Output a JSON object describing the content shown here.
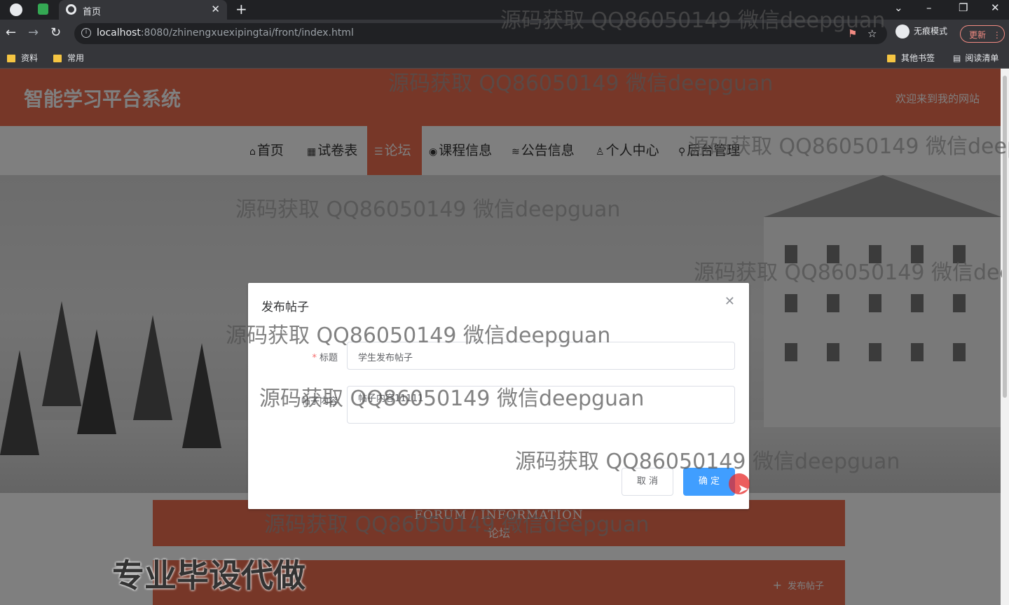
{
  "browser": {
    "tab_title": "首页",
    "new_tab": "+",
    "url_host": "localhost",
    "url_path": ":8080/zhinengxuexipingtai/front/index.html",
    "incognito_label": "无痕模式",
    "update_label": "更新",
    "bookmarks": [
      "资料",
      "常用"
    ],
    "bookmarks_right": [
      "其他书签",
      "阅读清单"
    ]
  },
  "site": {
    "title": "智能学习平台系统",
    "welcome": "欢迎来到我的网站",
    "nav": [
      {
        "icon": "⌂",
        "label": "首页"
      },
      {
        "icon": "▦",
        "label": "试卷表"
      },
      {
        "icon": "☰",
        "label": "论坛"
      },
      {
        "icon": "◉",
        "label": "课程信息"
      },
      {
        "icon": "≋",
        "label": "公告信息"
      },
      {
        "icon": "♙",
        "label": "个人中心"
      },
      {
        "icon": "⚲",
        "label": "后台管理"
      }
    ],
    "active_nav": "论坛"
  },
  "forum": {
    "en_title": "FORUM / INFORMATION",
    "cn_title": "论坛",
    "post_button": "发布帖子"
  },
  "dialog": {
    "title": "发布帖子",
    "title_label": "标题",
    "title_value": "学生发布帖子",
    "content_label": "帖子内容",
    "content_value": "帖子内容11111",
    "cancel": "取 消",
    "confirm": "确 定"
  },
  "watermark": {
    "text": "源码获取 QQ86050149 微信deepguan",
    "big_text": "专业毕设代做"
  },
  "colors": {
    "accent": "#ee6e50",
    "primary_button": "#409eff"
  }
}
